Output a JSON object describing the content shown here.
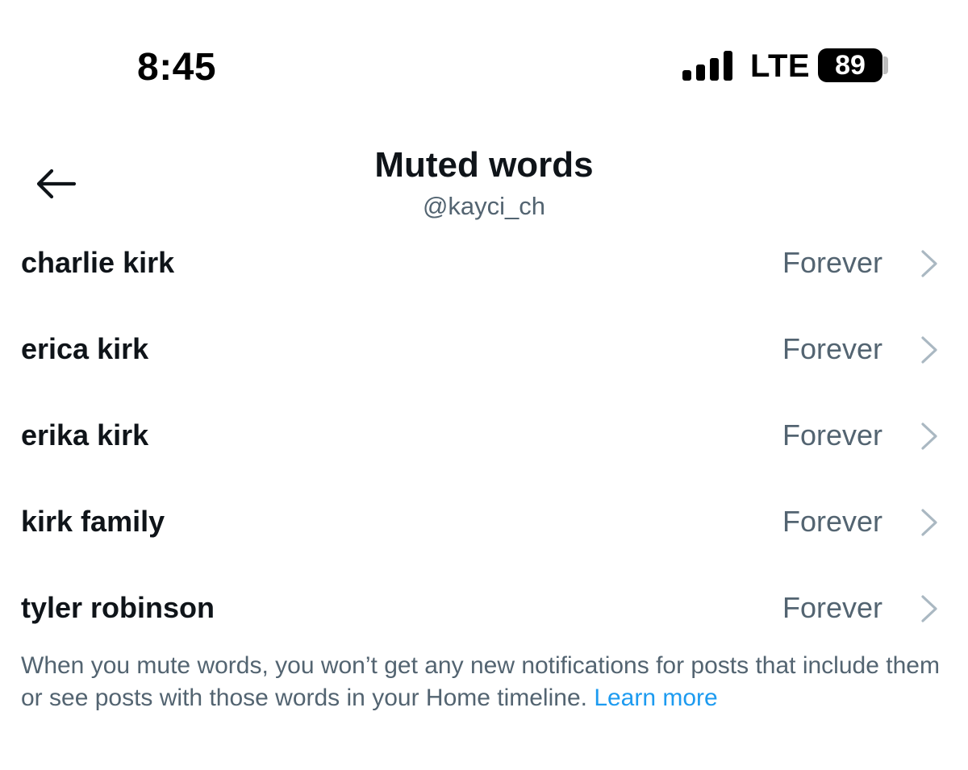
{
  "status_bar": {
    "time": "8:45",
    "network": "LTE",
    "battery": "89"
  },
  "header": {
    "title": "Muted words",
    "subtitle": "@kayci_ch",
    "back_icon": "arrow-left-icon"
  },
  "muted_words": [
    {
      "word": "charlie kirk",
      "duration": "Forever"
    },
    {
      "word": "erica kirk",
      "duration": "Forever"
    },
    {
      "word": "erika kirk",
      "duration": "Forever"
    },
    {
      "word": "kirk family",
      "duration": "Forever"
    },
    {
      "word": "tyler robinson",
      "duration": "Forever"
    }
  ],
  "footer": {
    "note": "When you mute words, you won’t get any new notifications for posts that include them or see posts with those words in your Home timeline.",
    "link": "Learn more"
  },
  "colors": {
    "primary_text": "#0f1419",
    "secondary_text": "#536471",
    "link": "#1d9bf0",
    "chevron": "#aab8c2"
  }
}
